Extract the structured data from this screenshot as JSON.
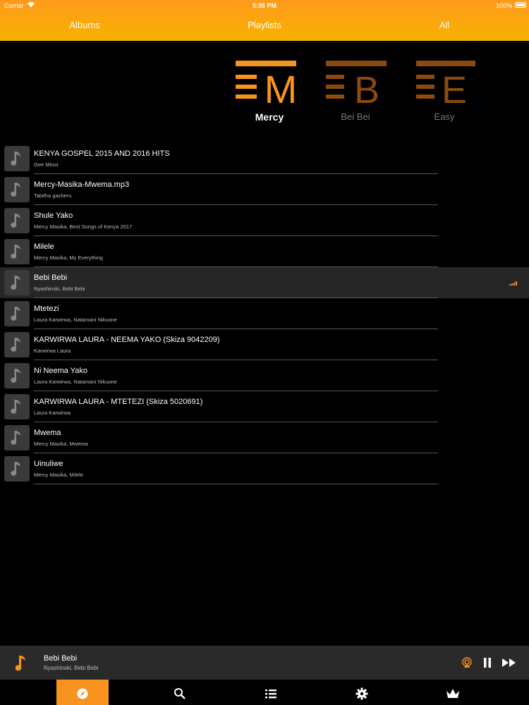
{
  "status_bar": {
    "carrier": "Carrier",
    "time": "5:36 PM",
    "battery": "100%"
  },
  "header_tabs": [
    {
      "label": "Albums"
    },
    {
      "label": "Playlists"
    },
    {
      "label": "All"
    }
  ],
  "playlists": [
    {
      "letter": "M",
      "label": "Mercy",
      "active": true
    },
    {
      "letter": "B",
      "label": "Bei Bei",
      "active": false
    },
    {
      "letter": "E",
      "label": "Easy",
      "active": false
    }
  ],
  "tracks": [
    {
      "title": "KENYA GOSPEL 2015 AND 2016 HITS",
      "subtitle": "Gee Minor"
    },
    {
      "title": "Mercy-Masika-Mwema.mp3",
      "subtitle": "Tabitha gacheru"
    },
    {
      "title": "Shule Yako",
      "subtitle": "Mercy Masika, Best Songs of Kenya 2017"
    },
    {
      "title": "Milele",
      "subtitle": "Mercy Masika, My Everything"
    },
    {
      "title": "Bebi Bebi",
      "subtitle": "Nyashinski, Bebi Bebi",
      "playing": true
    },
    {
      "title": "Mtetezi",
      "subtitle": "Laura Karwirwa, Natamani Nikuone"
    },
    {
      "title": "KARWIRWA LAURA - NEEMA YAKO (Skiza 9042209)",
      "subtitle": "Karwirwa Laura"
    },
    {
      "title": "Ni Neema Yako",
      "subtitle": "Laura Karwirwa, Natamani Nikuone"
    },
    {
      "title": "KARWIRWA LAURA - MTETEZI (Skiza 5020691)",
      "subtitle": "Laura Karwirwa"
    },
    {
      "title": "Mwema",
      "subtitle": "Mercy Masika, Mwema"
    },
    {
      "title": "Uinuliwe",
      "subtitle": "Mercy Masika, Milele"
    }
  ],
  "now_playing": {
    "title": "Bebi Bebi",
    "subtitle": "Nyashinski, Bebi Bebi"
  },
  "icons": {
    "track": "music-note-icon",
    "airplay": "airplay-icon",
    "pause": "pause-icon",
    "next": "fast-forward-icon",
    "tabbar": [
      "compass-icon",
      "search-icon",
      "list-icon",
      "gear-icon",
      "crown-icon"
    ]
  },
  "colors": {
    "accent": "#f7931e",
    "header_top": "#ff9a1c",
    "header_bottom": "#f7b200",
    "background": "#000000"
  }
}
